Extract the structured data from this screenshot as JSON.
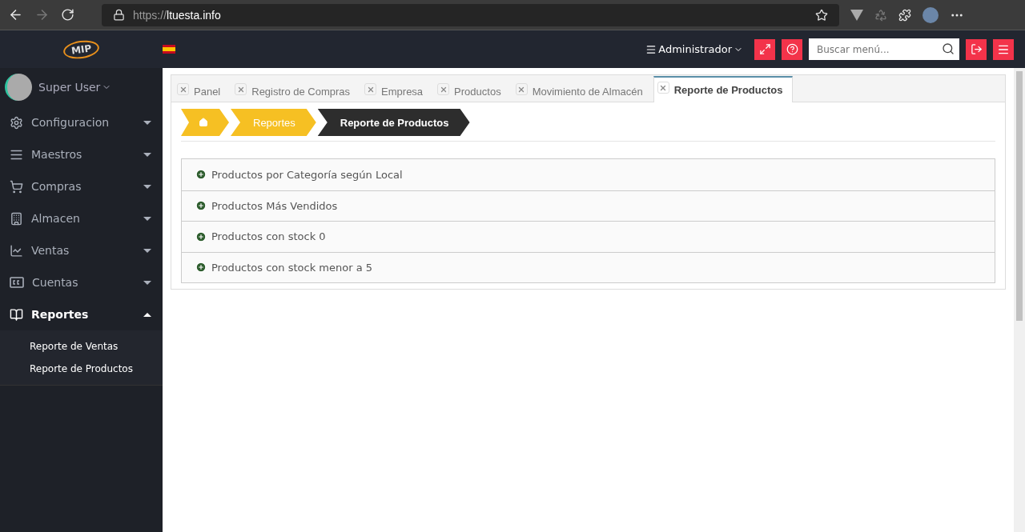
{
  "browser": {
    "url_scheme": "https://",
    "url_host": "ltuesta.info"
  },
  "header": {
    "logo_text": "MIP",
    "user_menu": "Administrador",
    "search": {
      "placeholder": "Buscar menú..."
    }
  },
  "sidebar": {
    "user": "Super User",
    "items": [
      {
        "label": "Configuracion",
        "kind": "gears",
        "expanded": false
      },
      {
        "label": "Maestros",
        "kind": "list",
        "expanded": false
      },
      {
        "label": "Compras",
        "kind": "cart",
        "expanded": false
      },
      {
        "label": "Almacen",
        "kind": "building",
        "expanded": false
      },
      {
        "label": "Ventas",
        "kind": "chart",
        "expanded": false
      },
      {
        "label": "Cuentas",
        "kind": "cc",
        "expanded": false
      },
      {
        "label": "Reportes",
        "kind": "book",
        "expanded": true,
        "children": [
          {
            "label": "Reporte de Ventas"
          },
          {
            "label": "Reporte de Productos"
          }
        ]
      }
    ]
  },
  "tabs": [
    {
      "label": "Panel",
      "selected": false
    },
    {
      "label": "Registro de Compras",
      "selected": false
    },
    {
      "label": "Empresa",
      "selected": false
    },
    {
      "label": "Productos",
      "selected": false
    },
    {
      "label": "Movimiento de Almacén",
      "selected": false
    },
    {
      "label": "Reporte de Productos",
      "selected": true
    }
  ],
  "breadcrumb": [
    {
      "kind": "home"
    },
    {
      "kind": "link",
      "label": "Reportes"
    },
    {
      "kind": "current",
      "label": "Reporte de Productos"
    }
  ],
  "reports": [
    {
      "label": "Productos por Categoría según Local"
    },
    {
      "label": "Productos Más Vendidos"
    },
    {
      "label": "Productos con stock 0"
    },
    {
      "label": "Productos con stock menor a 5"
    }
  ]
}
